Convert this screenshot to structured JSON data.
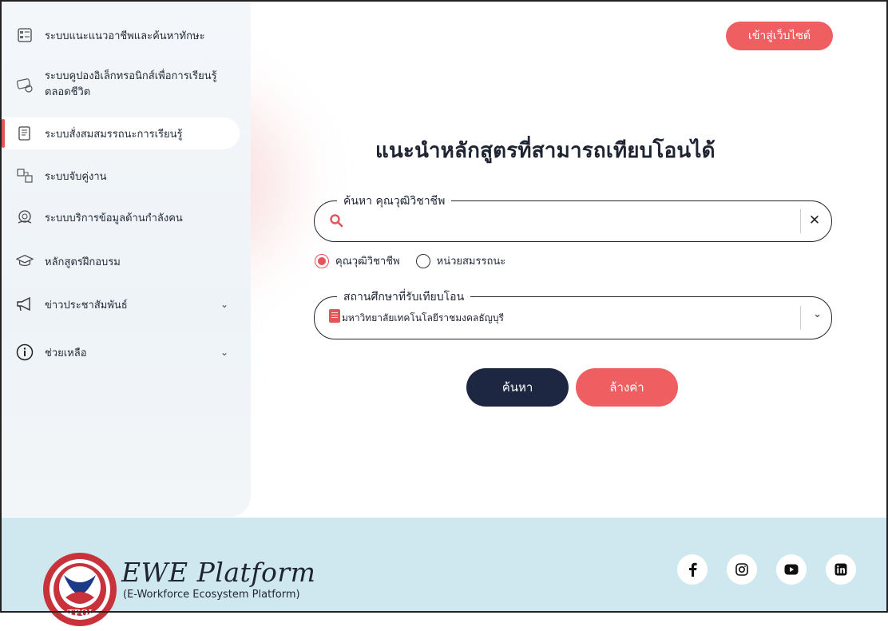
{
  "sidebar": {
    "items": [
      {
        "label": "ระบบแนะแนวอาชีพและค้นหาทักษะ",
        "icon": "career-guidance-icon"
      },
      {
        "label": "ระบบคูปองอิเล็กทรอนิกส์เพื่อการเรียนรู้ตลอดชีวิต",
        "label_line1": "ระบบคูปองอิเล็กทรอนิกส์เพื่อการเรียนรู้",
        "label_line2": "ตลอดชีวิต",
        "icon": "coupon-icon"
      },
      {
        "label": "ระบบสั่งสมสมรรถนะการเรียนรู้",
        "icon": "document-icon",
        "active": true
      },
      {
        "label": "ระบบจับคู่งาน",
        "icon": "job-matching-icon"
      },
      {
        "label": "ระบบบริการข้อมูลด้านกำลังคน",
        "icon": "workforce-data-icon"
      },
      {
        "label": "หลักสูตรฝึกอบรม",
        "icon": "graduation-cap-icon"
      },
      {
        "label": "ข่าวประชาสัมพันธ์",
        "icon": "megaphone-icon",
        "expandable": true
      },
      {
        "label": "ช่วยเหลือ",
        "icon": "info-icon",
        "expandable": true
      }
    ]
  },
  "header": {
    "website_button": "เข้าสู่เว็บไซต์"
  },
  "main": {
    "title": "แนะนำหลักสูตรที่สามารถเทียบโอนได้",
    "search": {
      "legend": "ค้นหา คุณวุฒิวิชาชีพ",
      "value": "",
      "placeholder": ""
    },
    "radios": [
      {
        "label": "คุณวุฒิวิชาชีพ",
        "selected": true
      },
      {
        "label": "หน่วยสมรรถนะ",
        "selected": false
      }
    ],
    "institution": {
      "legend": "สถานศึกษาที่รับเทียบโอน",
      "selected": "มหาวิทยาลัยเทคโนโลยีราชมงคลธัญบุรี"
    },
    "search_button": "ค้นหา",
    "clear_button": "ล้างค่า"
  },
  "footer": {
    "brand": "EWE Platform",
    "subtitle": "(E-Workforce Ecosystem Platform)",
    "seal_text": "TPQI",
    "social": [
      "facebook-icon",
      "instagram-icon",
      "youtube-icon",
      "linkedin-icon"
    ]
  },
  "colors": {
    "accent": "#ef5f62",
    "navy": "#1d2742",
    "footer_bg": "#cfe8ef"
  }
}
